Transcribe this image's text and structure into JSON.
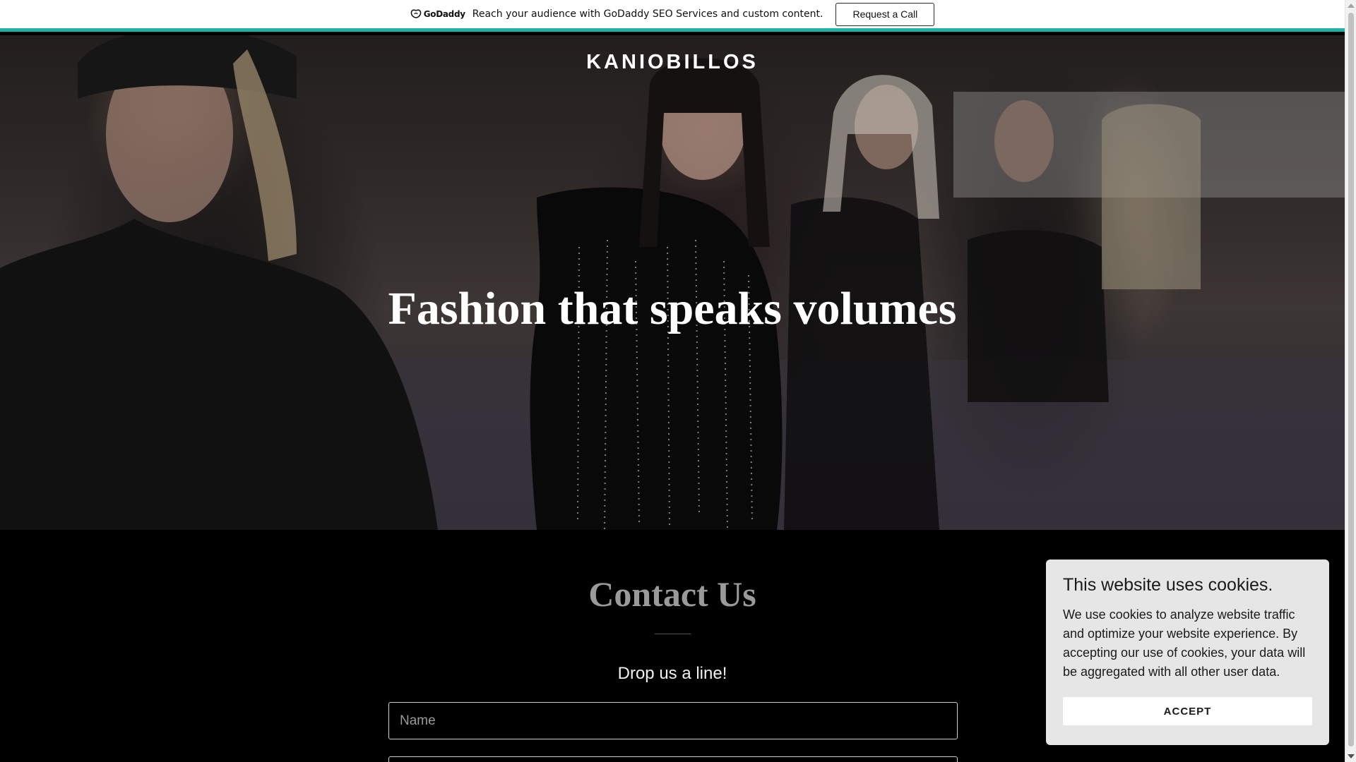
{
  "promo_bar": {
    "logo_text": "GoDaddy",
    "message": "Reach your audience with GoDaddy SEO Services and custom content.",
    "cta_label": "Request a Call",
    "accent_color": "#1bb5a6"
  },
  "hero": {
    "brand": "KANIOBILLOS",
    "headline": "Fashion that speaks volumes",
    "background": "runway-models-photo"
  },
  "contact": {
    "title": "Contact Us",
    "subtitle": "Drop us a line!",
    "fields": {
      "name_placeholder": "Name",
      "email_placeholder": ""
    }
  },
  "cookie_banner": {
    "title": "This website uses cookies.",
    "body": "We use cookies to analyze website traffic and optimize your website experience. By accepting our use of cookies, your data will be aggregated with all other user data.",
    "accept_label": "ACCEPT"
  },
  "colors": {
    "page_background": "#000000",
    "heading_gray": "#9a9a9a",
    "cookie_background": "#e6e6e6"
  }
}
